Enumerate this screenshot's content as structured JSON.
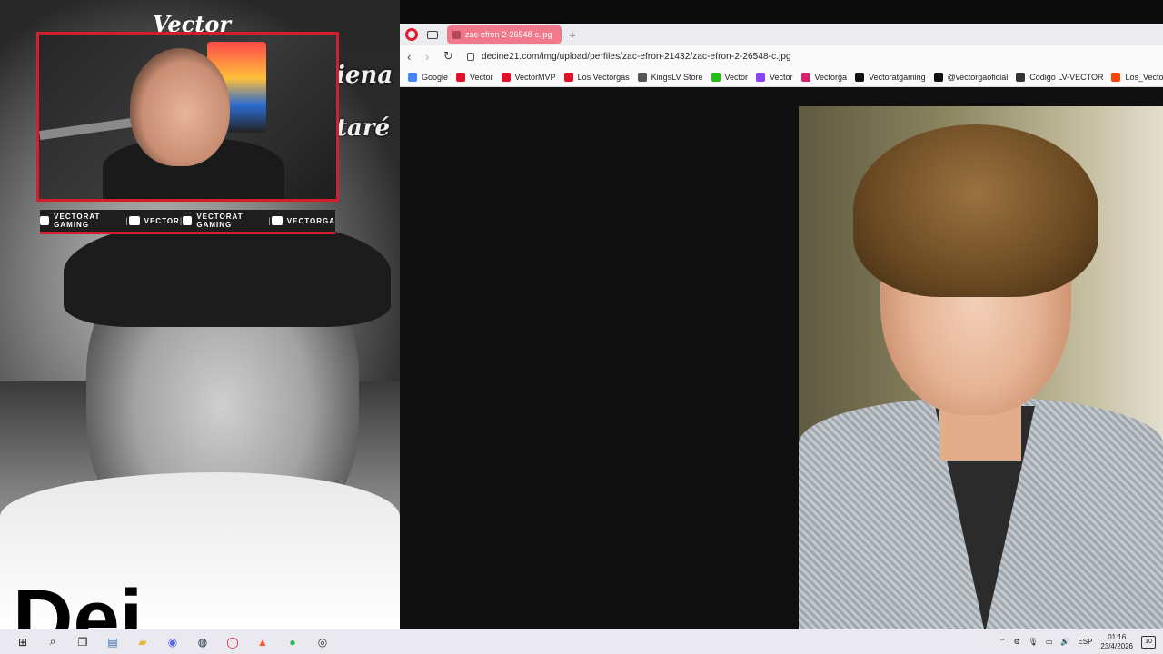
{
  "overlay": {
    "webcam_label": "Vector",
    "side_text_1": "iena",
    "side_text_2": "taré",
    "big_text": "Dei",
    "social": [
      {
        "platform": "youtube",
        "label": "VECTORAT GAMING"
      },
      {
        "platform": "twitch",
        "label": "VECTOR"
      },
      {
        "platform": "twitter",
        "label": "VECTORAT GAMING"
      },
      {
        "platform": "instagram",
        "label": "VECTORGA"
      }
    ]
  },
  "browser": {
    "tab_title": "zac-efron-2-26548-c.jpg",
    "new_tab": "+",
    "url": "decine21.com/img/upload/perfiles/zac-efron-21432/zac-efron-2-26548-c.jpg",
    "bookmarks": [
      {
        "label": "Google",
        "icon": "google-icon",
        "color": "#4285F4"
      },
      {
        "label": "Vector",
        "icon": "youtube-icon",
        "color": "#e0102a"
      },
      {
        "label": "VectorMVP",
        "icon": "youtube-icon",
        "color": "#e0102a"
      },
      {
        "label": "Los Vectorgas",
        "icon": "youtube-icon",
        "color": "#e0102a"
      },
      {
        "label": "KingsLV Store",
        "icon": "crown-icon",
        "color": "#555555"
      },
      {
        "label": "Vector",
        "icon": "kick-icon",
        "color": "#20c012"
      },
      {
        "label": "Vector",
        "icon": "twitch-icon",
        "color": "#8b44f7"
      },
      {
        "label": "Vectorga",
        "icon": "instagram-icon",
        "color": "#d3246f"
      },
      {
        "label": "Vectoratgaming",
        "icon": "x-icon",
        "color": "#111111"
      },
      {
        "label": "@vectorgaoficial",
        "icon": "tiktok-icon",
        "color": "#111111"
      },
      {
        "label": "Codigo LV-VECTOR",
        "icon": "store-icon",
        "color": "#333333"
      },
      {
        "label": "Los_Vectorga",
        "icon": "reddit-icon",
        "color": "#ff4500"
      }
    ]
  },
  "taskbar": {
    "apps": [
      "start-icon",
      "search-icon",
      "task-view-icon",
      "explorer-icon",
      "file-folder-icon",
      "discord-icon",
      "steam-icon",
      "opera-icon",
      "brave-icon",
      "spotify-icon",
      "obs-icon"
    ],
    "language": "ESP",
    "time": "01:16",
    "date": "23/4/2026",
    "notifications": "10"
  }
}
